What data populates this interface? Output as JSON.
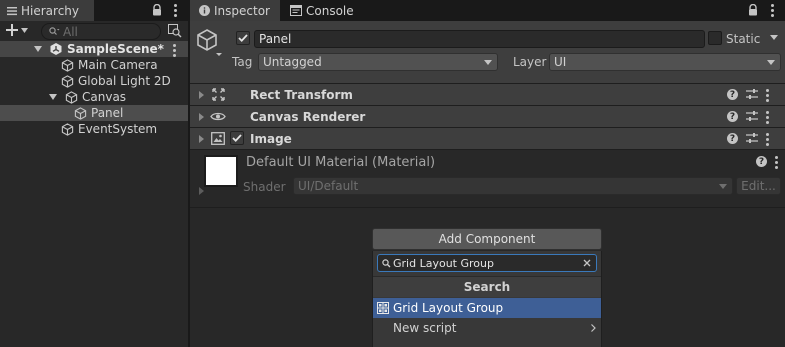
{
  "hierarchy": {
    "tab_label": "Hierarchy",
    "search_placeholder": "All",
    "scene_name": "SampleScene*",
    "items": [
      {
        "label": "Main Camera"
      },
      {
        "label": "Global Light 2D"
      },
      {
        "label": "Canvas"
      },
      {
        "label": "Panel"
      },
      {
        "label": "EventSystem"
      }
    ]
  },
  "inspector": {
    "tabs": [
      {
        "label": "Inspector"
      },
      {
        "label": "Console"
      }
    ],
    "object_name": "Panel",
    "static_label": "Static",
    "tag_label": "Tag",
    "tag_value": "Untagged",
    "layer_label": "Layer",
    "layer_value": "UI",
    "components": [
      {
        "label": "Rect Transform"
      },
      {
        "label": "Canvas Renderer"
      },
      {
        "label": "Image"
      }
    ],
    "material": {
      "title": "Default UI Material (Material)",
      "shader_label": "Shader",
      "shader_value": "UI/Default",
      "edit_label": "Edit..."
    }
  },
  "add_component": {
    "button_label": "Add Component",
    "search_value": "Grid Layout Group",
    "section_label": "Search",
    "results": [
      {
        "label": "Grid Layout Group"
      },
      {
        "label": "New script"
      }
    ]
  },
  "colors": {
    "selection": "#2c5d87",
    "result_highlight": "#3e5f96",
    "search_focus": "#3a79bb",
    "panel_bg": "#282828",
    "header_bg": "#3e3e3e"
  }
}
